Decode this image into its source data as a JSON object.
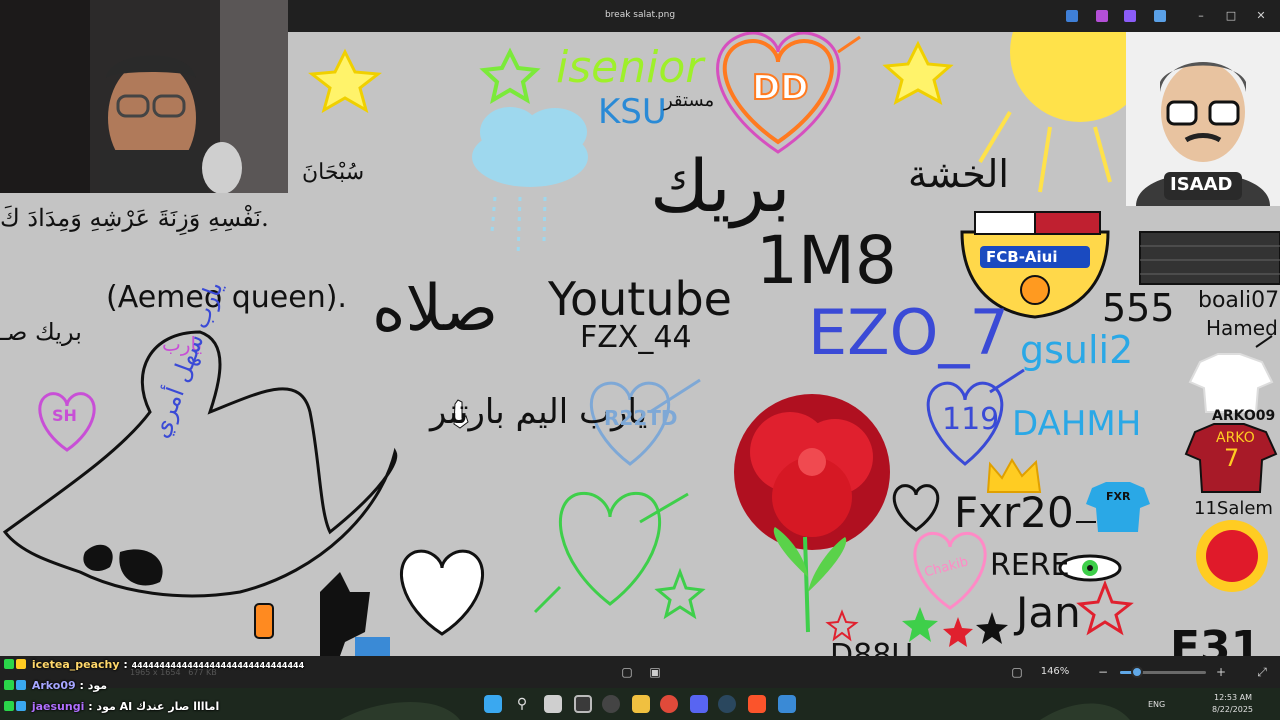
{
  "window": {
    "title": "break salat.png"
  },
  "drawing": {
    "arabic_tasbih_top": "سُبْحَانَ",
    "arabic_tasbih_line": "نَفْسِهِ وَزِنَةَ عَرْشِهِ وَمِدَادَ كَ.",
    "isenior": "isenior",
    "ksu": "KSU",
    "mustaqir": "مستقر",
    "dd": "DD",
    "break_arabic": "بريك",
    "khashna": "الخشة",
    "salah": "صلاه",
    "aemeo_queen": "(Aemeo queen).",
    "break_left": "بريك صـ",
    "youtube": "Youtube",
    "fzx44": "FZX_44",
    "one_m_eight": "1M8",
    "ya_rab_top": "يارب",
    "ya_rab_sahel": "يارب سهل أمري",
    "ya_rab_barca": "يارب اليم بارتنر",
    "r22td": "R22TD",
    "ezo7": "EZO_7",
    "gsuli2": "gsuli2",
    "n555": "555",
    "boali": "boali07",
    "hamed": "Hamed",
    "arko009": "ARKO09",
    "arko_shirt": "ARKO",
    "shirt7": "7",
    "n119": "119",
    "dahmh": "DAHMH",
    "fxr20": "Fxr20",
    "fxr_shirt": "FXR",
    "rere": "RERE",
    "jan": "Jan",
    "salem": "11Salem",
    "chakib": "Chakib",
    "sh": "SH",
    "fcb": "FCB-Aiui",
    "bottom_partial": "D88U",
    "bottom_right": "F31"
  },
  "avatar": {
    "name": "ISAAD"
  },
  "viewer": {
    "image_info": "1965 x 1654",
    "file_size": "677 KB",
    "zoom": "146%",
    "zoom_fraction": 0.2
  },
  "chat": {
    "messages": [
      {
        "user": "icetea_peachy",
        "text": "4444444444444444444444444444444",
        "color": "#ffd86b"
      },
      {
        "user": "Arko09",
        "text": "مود",
        "color": "#a6a6ff"
      },
      {
        "user": "jaesungi",
        "text": "مود AI اماااا صار عندك",
        "color": "#b070ff"
      }
    ]
  },
  "taskbar": {
    "lang": "ENG",
    "time": "12:53 AM",
    "date": "8/22/2025"
  }
}
